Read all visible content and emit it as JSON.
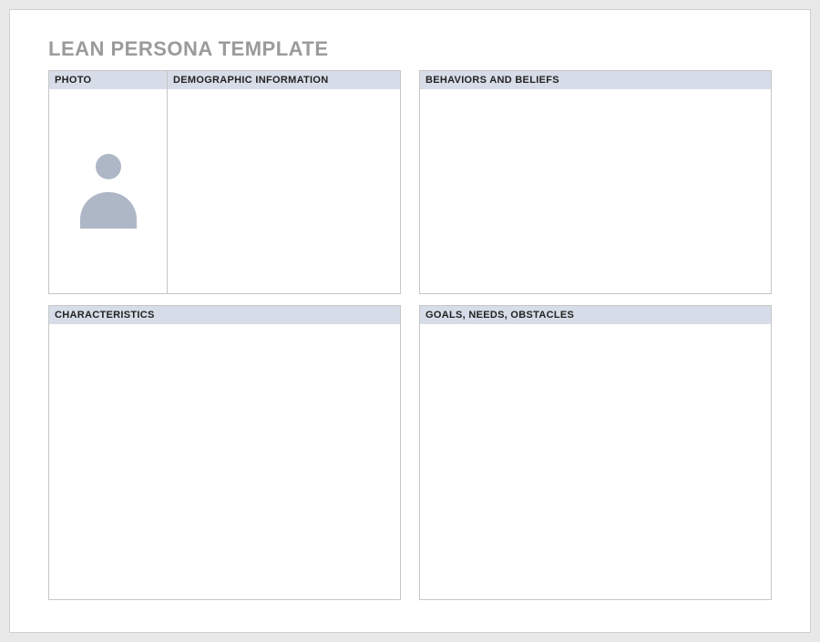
{
  "title": "LEAN PERSONA TEMPLATE",
  "panels": {
    "photo": {
      "label": "PHOTO"
    },
    "demographic": {
      "label": "DEMOGRAPHIC INFORMATION"
    },
    "behaviors": {
      "label": "BEHAVIORS AND BELIEFS"
    },
    "characteristics": {
      "label": "CHARACTERISTICS"
    },
    "goals": {
      "label": "GOALS, NEEDS, OBSTACLES"
    }
  }
}
